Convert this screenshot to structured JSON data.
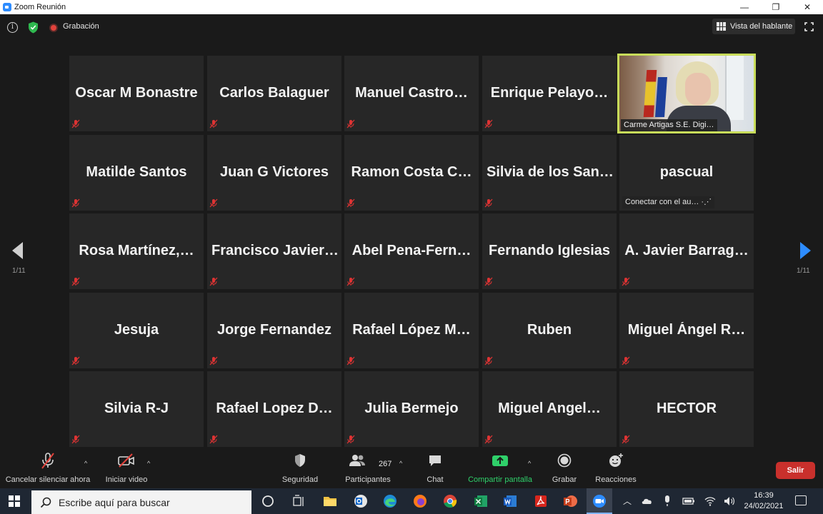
{
  "window": {
    "title": "Zoom Reunión",
    "minimize_glyph": "—",
    "maximize_glyph": "❐",
    "close_glyph": "✕"
  },
  "topbar": {
    "info_glyph": "i",
    "recording_label": "Grabación",
    "view_button_label": "Vista del hablante"
  },
  "grid": {
    "tiles": [
      {
        "name": "Oscar M Bonastre"
      },
      {
        "name": "Carlos Balaguer"
      },
      {
        "name": "Manuel  Castro…"
      },
      {
        "name": "Enrique  Pelayo…"
      },
      {
        "name": "Matilde Santos"
      },
      {
        "name": "Juan G Victores"
      },
      {
        "name": "Ramon  Costa  C…"
      },
      {
        "name": "Silvia de los San…"
      },
      {
        "name": "pascual",
        "hint": "Conectar con el au…  ·⋰"
      },
      {
        "name": "Rosa  Martínez,…"
      },
      {
        "name": "Francisco  Javier…"
      },
      {
        "name": "Abel  Pena-Fern…"
      },
      {
        "name": "Fernando Iglesias"
      },
      {
        "name": "A.  Javier  Barrag…"
      },
      {
        "name": "Jesuja"
      },
      {
        "name": "Jorge Fernandez"
      },
      {
        "name": "Rafael  López  M…"
      },
      {
        "name": "Ruben"
      },
      {
        "name": "Miguel  Ángel  R…"
      },
      {
        "name": "Silvia R-J"
      },
      {
        "name": "Rafael  Lopez  D…"
      },
      {
        "name": "Julia Bermejo"
      },
      {
        "name": "Miguel  Angel…"
      },
      {
        "name": "HECTOR"
      }
    ],
    "video_tile": {
      "name": "Carme Artigas S.E. Digi…"
    }
  },
  "pagination": {
    "left": "1/11",
    "right": "1/11"
  },
  "toolbar": {
    "unmute_label": "Cancelar silenciar ahora",
    "start_video_label": "Iniciar video",
    "security_label": "Seguridad",
    "participants_label": "Participantes",
    "participants_count": "267",
    "chat_label": "Chat",
    "share_label": "Compartir pantalla",
    "record_label": "Grabar",
    "reactions_label": "Reacciones",
    "leave_label": "Salir",
    "caret": "^"
  },
  "taskbar": {
    "search_placeholder": "Escribe aquí para buscar",
    "time": "16:39",
    "date": "24/02/2021"
  },
  "colors": {
    "accent_blue": "#2d8cff",
    "leave_red": "#c9302c",
    "share_green": "#2fd06a",
    "active_speaker_border": "#c8dc5a"
  }
}
